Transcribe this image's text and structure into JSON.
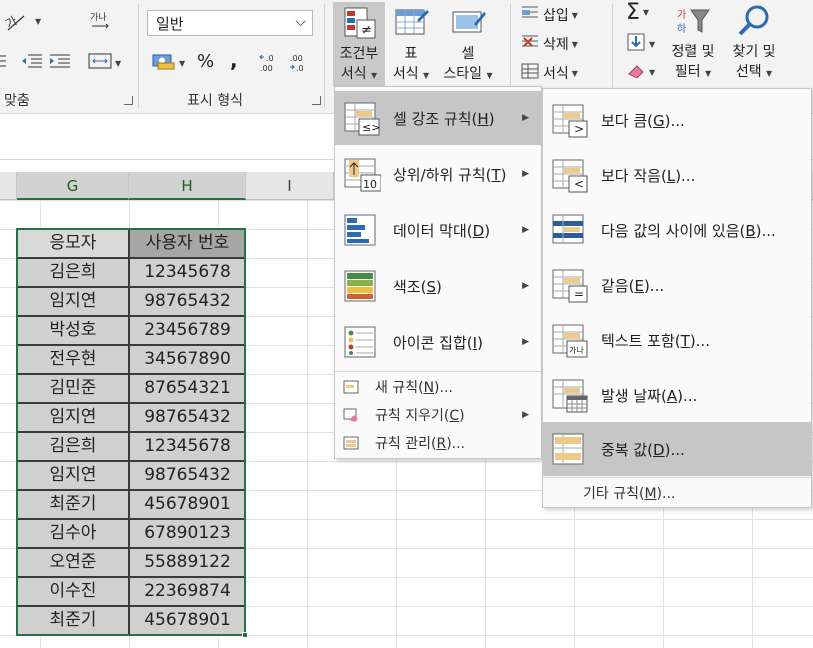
{
  "ribbon": {
    "alignment_group_label": "맞춤",
    "number_group_label": "표시 형식",
    "number_format_value": "일반",
    "percent_symbol": "%",
    "comma_symbol": ",",
    "increase_decimal_label": ".0\n.00",
    "decrease_decimal_label": ".00\n.0",
    "conditional_formatting": {
      "line1": "조건부",
      "line2": "서식"
    },
    "format_as_table": {
      "line1": "표",
      "line2": "서식"
    },
    "cell_styles": {
      "line1": "셀",
      "line2": "스타일"
    },
    "insert_label": "삽입",
    "delete_label": "삭제",
    "format_label": "서식",
    "sum_symbol": "Σ",
    "sort_filter": {
      "line1": "정렬 및",
      "line2": "필터"
    },
    "find_select": {
      "line1": "찾기 및",
      "line2": "선택"
    }
  },
  "sheet": {
    "columns": [
      "G",
      "H",
      "I"
    ],
    "headers": [
      "응모자",
      "사용자 번호"
    ],
    "rows": [
      [
        "김은희",
        "12345678"
      ],
      [
        "임지연",
        "98765432"
      ],
      [
        "박성호",
        "23456789"
      ],
      [
        "전우현",
        "34567890"
      ],
      [
        "김민준",
        "87654321"
      ],
      [
        "임지연",
        "98765432"
      ],
      [
        "김은희",
        "12345678"
      ],
      [
        "임지연",
        "98765432"
      ],
      [
        "최준기",
        "45678901"
      ],
      [
        "김수아",
        "67890123"
      ],
      [
        "오연준",
        "55889122"
      ],
      [
        "이수진",
        "22369874"
      ],
      [
        "최준기",
        "45678901"
      ]
    ]
  },
  "cf_menu": {
    "items": [
      {
        "label": "셀 강조 규칙",
        "key": "H"
      },
      {
        "label": "상위/하위 규칙",
        "key": "T"
      },
      {
        "label": "데이터 막대",
        "key": "D"
      },
      {
        "label": "색조",
        "key": "S"
      },
      {
        "label": "아이콘 집합",
        "key": "I"
      }
    ],
    "small_items": [
      {
        "label": "새 규칙",
        "key": "N",
        "suffix": "..."
      },
      {
        "label": "규칙 지우기",
        "key": "C",
        "suffix": ""
      },
      {
        "label": "규칙 관리",
        "key": "R",
        "suffix": "..."
      }
    ]
  },
  "highlight_menu": {
    "items": [
      {
        "label": "보다 큼",
        "key": "G"
      },
      {
        "label": "보다 작음",
        "key": "L"
      },
      {
        "label": "다음 값의 사이에 있음",
        "key": "B"
      },
      {
        "label": "같음",
        "key": "E"
      },
      {
        "label": "텍스트 포함",
        "key": "T"
      },
      {
        "label": "발생 날짜",
        "key": "A"
      },
      {
        "label": "중복 값",
        "key": "D"
      }
    ],
    "more_rules": {
      "label": "기타 규칙",
      "key": "M"
    }
  },
  "colors": {
    "accent_green": "#217346",
    "highlight": "#c6c6c6"
  }
}
